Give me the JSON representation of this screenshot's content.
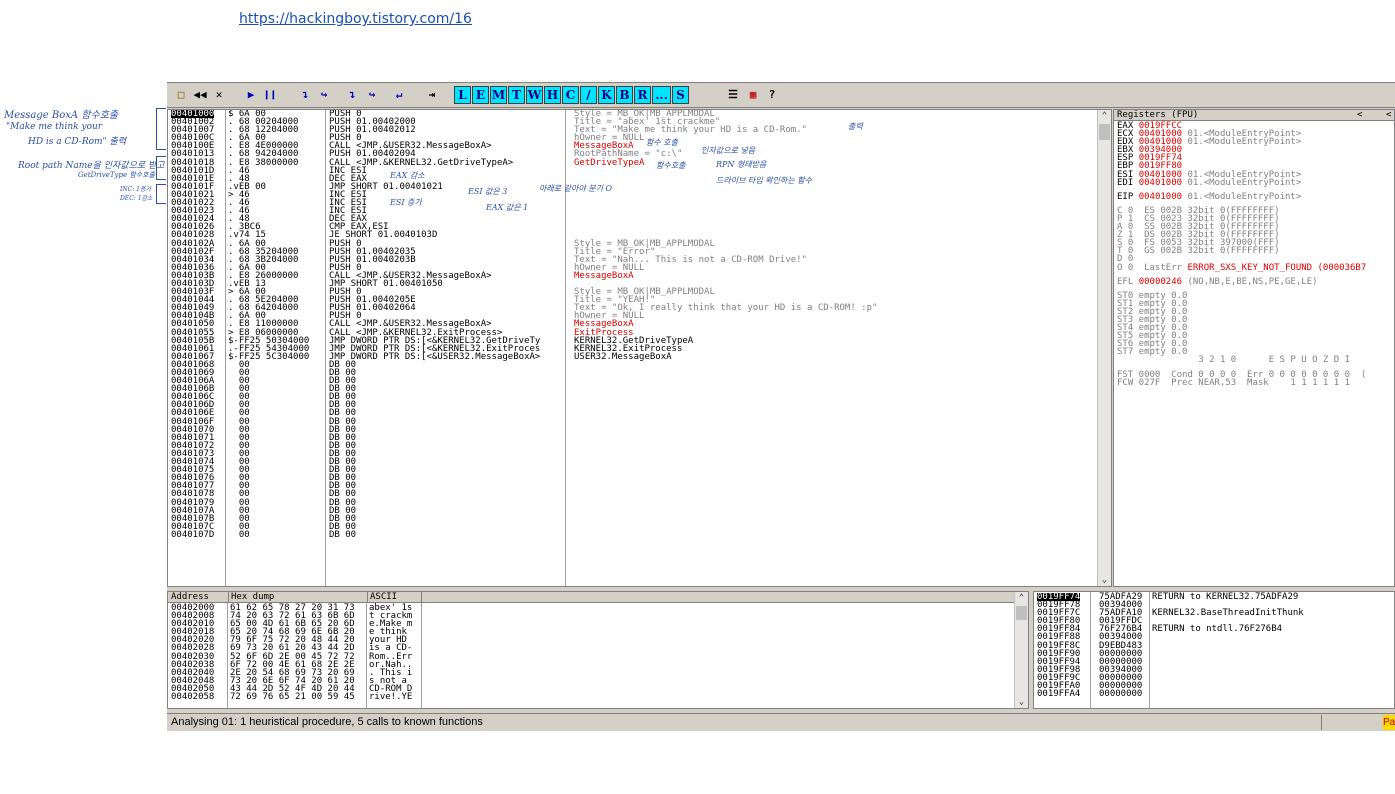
{
  "page": {
    "link": "https://hackingboy.tistory.com/16"
  },
  "handwritten_notes": {
    "n1": "Message BoxA 함수호출",
    "n2": "\"Make me think your",
    "n3": "HD is a CD-Rom\" 출력",
    "n4": "Root path Name을 인자값으로 받고",
    "n5": "GetDriveType 함수호출",
    "n6": "INC: 1증가",
    "n7": "DEC: 1감소"
  },
  "toolbar": {
    "letters": [
      "L",
      "E",
      "M",
      "T",
      "W",
      "H",
      "C",
      "/",
      "K",
      "B",
      "R",
      "...",
      "S"
    ],
    "icons": [
      "open-icon",
      "restart-icon",
      "close-icon",
      "run-icon",
      "pause-icon",
      "step-into-icon",
      "step-over-icon",
      "trace-into-icon",
      "trace-over-icon",
      "execute-till-return-icon",
      "go-to-icon"
    ]
  },
  "disasm": {
    "addresses": [
      "00401000",
      "00401002",
      "00401007",
      "0040100C",
      "0040100E",
      "00401013",
      "00401018",
      "0040101D",
      "0040101E",
      "0040101F",
      "00401021",
      "00401022",
      "00401023",
      "00401024",
      "00401026",
      "00401028",
      "0040102A",
      "0040102F",
      "00401034",
      "00401036",
      "0040103B",
      "0040103D",
      "0040103F",
      "00401044",
      "00401049",
      "0040104B",
      "00401050",
      "00401055",
      "0040105B",
      "00401061",
      "00401067",
      "00401068",
      "00401069",
      "0040106A",
      "0040106B",
      "0040106C",
      "0040106D",
      "0040106E",
      "0040106F",
      "00401070",
      "00401071",
      "00401072",
      "00401073",
      "00401074",
      "00401075",
      "00401076",
      "00401077",
      "00401078",
      "00401079",
      "0040107A",
      "0040107B",
      "0040107C",
      "0040107D"
    ],
    "hex": [
      "$ 6A 00",
      ". 68 00204000",
      ". 68 12204000",
      ". 6A 00",
      ". E8 4E000000",
      ". 68 94204000",
      ". E8 38000000",
      ". 46",
      ". 48",
      ".vEB 00",
      "> 46",
      ". 46",
      ". 46",
      ". 48",
      ". 3BC6",
      ".v74 15",
      ". 6A 00",
      ". 68 35204000",
      ". 68 3B204000",
      ". 6A 00",
      ". E8 26000000",
      ".vEB 13",
      "> 6A 00",
      ". 68 5E204000",
      ". 68 64204000",
      ". 6A 00",
      ". E8 11000000",
      "> E8 06000000",
      "$-FF25 50304000",
      ".-FF25 54304000",
      "$-FF25 5C304000",
      "  00",
      "  00",
      "  00",
      "  00",
      "  00",
      "  00",
      "  00",
      "  00",
      "  00",
      "  00",
      "  00",
      "  00",
      "  00",
      "  00",
      "  00",
      "  00",
      "  00",
      "  00",
      "  00",
      "  00",
      "  00",
      "  00"
    ],
    "mnemonics": [
      "PUSH 0",
      "PUSH 01.00402000",
      "PUSH 01.00402012",
      "PUSH 0",
      "CALL <JMP.&USER32.MessageBoxA>",
      "PUSH 01.00402094",
      "CALL <JMP.&KERNEL32.GetDriveTypeA>",
      "INC ESI",
      "DEC EAX",
      "JMP SHORT 01.00401021",
      "INC ESI",
      "INC ESI",
      "INC ESI",
      "DEC EAX",
      "CMP EAX,ESI",
      "JE SHORT 01.0040103D",
      "PUSH 0",
      "PUSH 01.00402035",
      "PUSH 01.0040203B",
      "PUSH 0",
      "CALL <JMP.&USER32.MessageBoxA>",
      "JMP SHORT 01.00401050",
      "PUSH 0",
      "PUSH 01.0040205E",
      "PUSH 01.00402064",
      "PUSH 0",
      "CALL <JMP.&USER32.MessageBoxA>",
      "CALL <JMP.&KERNEL32.ExitProcess>",
      "JMP DWORD PTR DS:[<&KERNEL32.GetDriveTy",
      "JMP DWORD PTR DS:[<&KERNEL32.ExitProces",
      "JMP DWORD PTR DS:[<&USER32.MessageBoxA>",
      "DB 00",
      "DB 00",
      "DB 00",
      "DB 00",
      "DB 00",
      "DB 00",
      "DB 00",
      "DB 00",
      "DB 00",
      "DB 00",
      "DB 00",
      "DB 00",
      "DB 00",
      "DB 00",
      "DB 00",
      "DB 00",
      "DB 00",
      "DB 00",
      "DB 00",
      "DB 00",
      "DB 00",
      "DB 00"
    ],
    "comments": [
      "Style = MB_OK|MB_APPLMODAL",
      "Title = \"abex' 1st crackme\"",
      "Text = \"Make me think your HD is a CD-Rom.\"",
      "hOwner = NULL",
      "MessageBoxA",
      "RootPathName = \"c:\\\"",
      "GetDriveTypeA",
      "",
      "",
      "",
      "",
      "",
      "",
      "",
      "",
      "",
      "Style = MB_OK|MB_APPLMODAL",
      "Title = \"Error\"",
      "Text = \"Nah... This is not a CD-ROM Drive!\"",
      "hOwner = NULL",
      "MessageBoxA",
      "",
      "Style = MB_OK|MB_APPLMODAL",
      "Title = \"YEAH!\"",
      "Text = \"Ok, I really think that your HD is a CD-ROM! :p\"",
      "hOwner = NULL",
      "MessageBoxA",
      "ExitProcess",
      "KERNEL32.GetDriveTypeA",
      "KERNEL32.ExitProcess",
      "USER32.MessageBoxA"
    ],
    "annotations": {
      "a1": "출력",
      "a2": "함수 호출",
      "a3": "인자값으로 넣음",
      "a4": "함수호출",
      "a5": "RPN 형태받음",
      "a6": "드라이브 타입 확인하는 함수",
      "a7": "EAX 감소",
      "a8": "ESI 증가",
      "a9": "ESI 값은 3",
      "a10": "EAX 값은 1",
      "a11": "아래로 같아야 분기 O"
    }
  },
  "registers": {
    "title": "Registers (FPU)",
    "rows": [
      {
        "name": "EAX",
        "value": "0019FFCC",
        "desc": ""
      },
      {
        "name": "ECX",
        "value": "00401000",
        "desc": "01.<ModuleEntryPoint>"
      },
      {
        "name": "EDX",
        "value": "00401000",
        "desc": "01.<ModuleEntryPoint>"
      },
      {
        "name": "EBX",
        "value": "00394000",
        "desc": ""
      },
      {
        "name": "ESP",
        "value": "0019FF74",
        "desc": ""
      },
      {
        "name": "EBP",
        "value": "0019FF80",
        "desc": ""
      },
      {
        "name": "ESI",
        "value": "00401000",
        "desc": "01.<ModuleEntryPoint>"
      },
      {
        "name": "EDI",
        "value": "00401000",
        "desc": "01.<ModuleEntryPoint>"
      }
    ],
    "eip": {
      "name": "EIP",
      "value": "00401000",
      "desc": "01.<ModuleEntryPoint>"
    },
    "flags": [
      "C 0  ES 002B 32bit 0(FFFFFFFF)",
      "P 1  CS 0023 32bit 0(FFFFFFFF)",
      "A 0  SS 002B 32bit 0(FFFFFFFF)",
      "Z 1  DS 002B 32bit 0(FFFFFFFF)",
      "S 0  FS 0053 32bit 397000(FFF)",
      "T 0  GS 002B 32bit 0(FFFFFFFF)",
      "D 0"
    ],
    "lasterr_prefix": "O 0  LastErr",
    "lasterr": "ERROR_SXS_KEY_NOT_FOUND (000036B7",
    "efl_prefix": "EFL",
    "efl": "00000246",
    "efl_desc": "(NO,NB,E,BE,NS,PE,GE,LE)",
    "fpu": [
      "ST0 empty 0.0",
      "ST1 empty 0.0",
      "ST2 empty 0.0",
      "ST3 empty 0.0",
      "ST4 empty 0.0",
      "ST5 empty 0.0",
      "ST6 empty 0.0",
      "ST7 empty 0.0"
    ],
    "fst_bits": "               3 2 1 0      E S P U O Z D I",
    "fst": "FST 0000  Cond 0 0 0 0  Err 0 0 0 0 0 0 0 0  (",
    "fcw": "FCW 027F  Prec NEAR,53  Mask    1 1 1 1 1 1"
  },
  "dump": {
    "headers": [
      "Address",
      "Hex dump",
      "ASCII"
    ],
    "addresses": [
      "00402000",
      "00402008",
      "00402010",
      "00402018",
      "00402020",
      "00402028",
      "00402030",
      "00402038",
      "00402040",
      "00402048",
      "00402050",
      "00402058"
    ],
    "hex": [
      "61 62 65 78 27 20 31 73",
      "74 20 63 72 61 63 6B 6D",
      "65 00 4D 61 6B 65 20 6D",
      "65 20 74 68 69 6E 6B 20",
      "79 6F 75 72 20 48 44 20",
      "69 73 20 61 20 43 44 2D",
      "52 6F 6D 2E 00 45 72 72",
      "6F 72 00 4E 61 68 2E 2E",
      "2E 20 54 68 69 73 20 69",
      "73 20 6E 6F 74 20 61 20",
      "43 44 2D 52 4F 4D 20 44",
      "72 69 76 65 21 00 59 45"
    ],
    "ascii": [
      "abex' 1s",
      "t crackm",
      "e.Make m",
      "e think ",
      "your HD ",
      "is a CD-",
      "Rom..Err",
      "or.Nah..",
      ". This i",
      "s not a ",
      "CD-ROM D",
      "rive!.YE"
    ]
  },
  "stack": {
    "addresses": [
      "0019FF74",
      "0019FF78",
      "0019FF7C",
      "0019FF80",
      "0019FF84",
      "0019FF88",
      "0019FF8C",
      "0019FF90",
      "0019FF94",
      "0019FF98",
      "0019FF9C",
      "0019FFA0",
      "0019FFA4"
    ],
    "values": [
      "75ADFA29",
      "00394000",
      "75ADFA10",
      "0019FFDC",
      "76F276B4",
      "00394000",
      "D9EBD483",
      "00000000",
      "00000000",
      "00394000",
      "00000000",
      "00000000",
      "00000000"
    ],
    "comments": [
      "RETURN to KERNEL32.75ADFA29",
      "",
      "KERNEL32.BaseThreadInitThunk",
      "",
      "RETURN to ntdll.76F276B4",
      "",
      "",
      "",
      "",
      "",
      "",
      "",
      ""
    ]
  },
  "status": {
    "text": "Analysing 01: 1 heuristical procedure, 5 calls to known functions",
    "badge": "Pa"
  }
}
